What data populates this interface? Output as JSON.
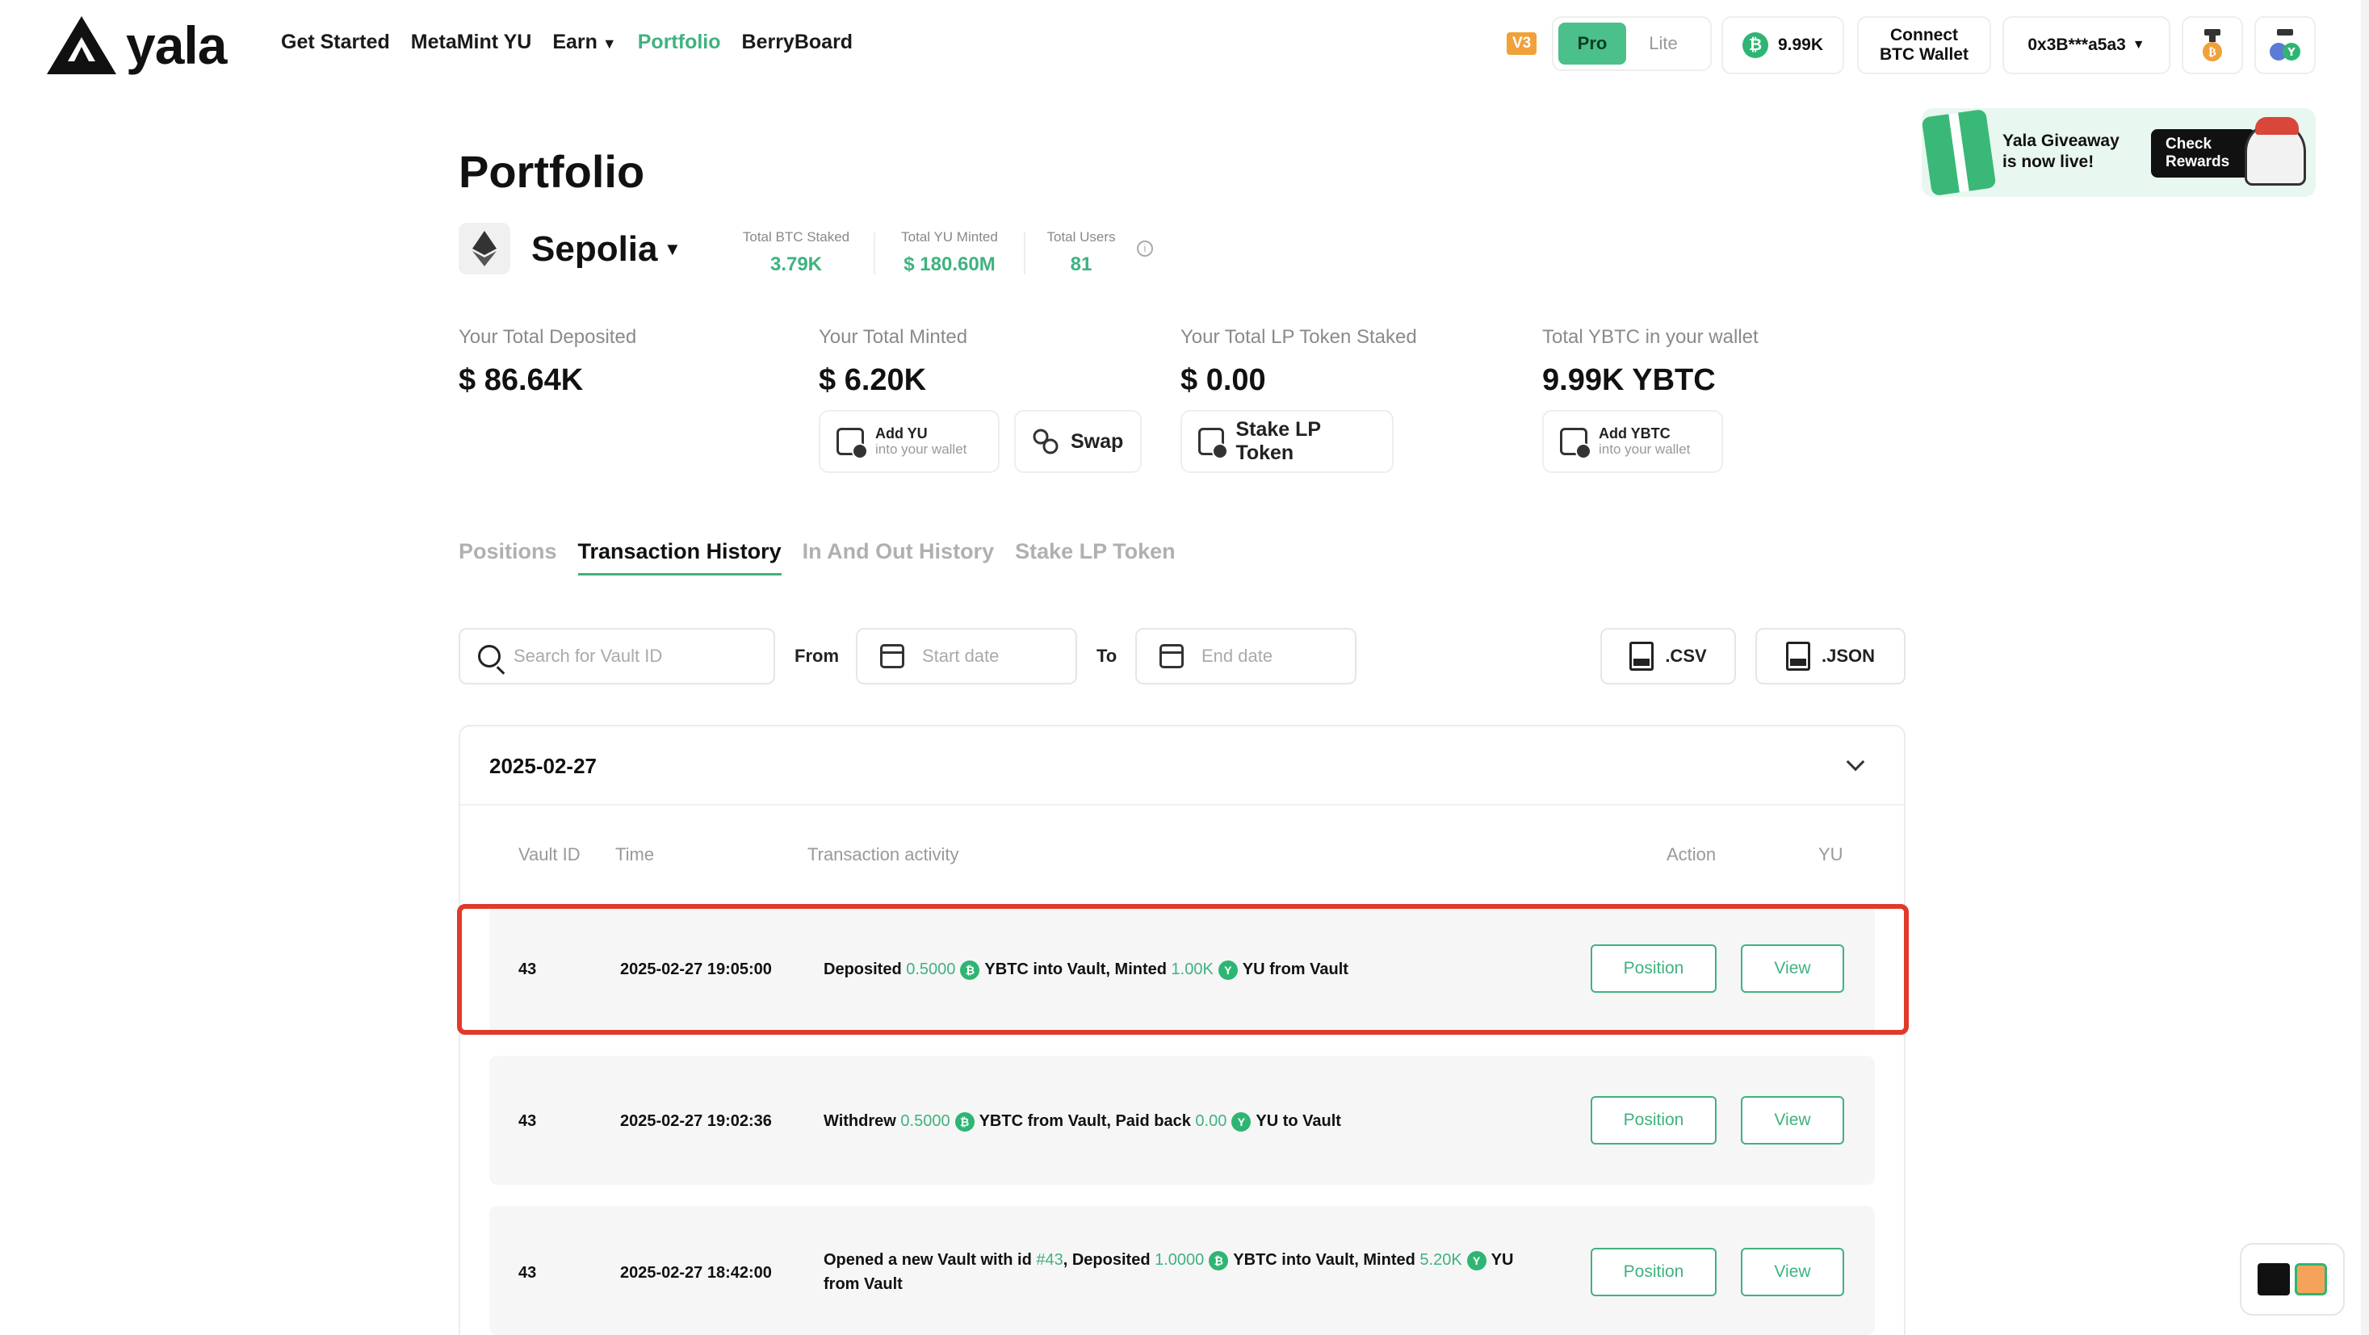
{
  "header": {
    "logo_text": "yala",
    "nav": [
      "Get Started",
      "MetaMint YU",
      "Earn",
      "Portfolio",
      "BerryBoard"
    ],
    "version_badge": "V3",
    "mode": {
      "pro": "Pro",
      "lite": "Lite"
    },
    "balance": "9.99K",
    "connect_line1": "Connect",
    "connect_line2": "BTC Wallet",
    "address": "0x3B***a5a3"
  },
  "giveaway": {
    "line1": "Yala Giveaway",
    "line2": "is now live!",
    "button_line1": "Check",
    "button_line2": "Rewards"
  },
  "page": {
    "title": "Portfolio",
    "network": "Sepolia",
    "stats": [
      {
        "label": "Total BTC Staked",
        "value": "3.79K"
      },
      {
        "label": "Total YU Minted",
        "value": "$ 180.60M"
      },
      {
        "label": "Total Users",
        "value": "81"
      }
    ]
  },
  "summary": [
    {
      "label": "Your Total Deposited",
      "value": "$ 86.64K"
    },
    {
      "label": "Your Total Minted",
      "value": "$ 6.20K"
    },
    {
      "label": "Your Total LP Token Staked",
      "value": "$ 0.00"
    },
    {
      "label": "Total YBTC in your wallet",
      "value": "9.99K YBTC"
    }
  ],
  "actions": {
    "add_yu": {
      "title": "Add YU",
      "sub": "into your wallet"
    },
    "swap": "Swap",
    "stake_lp": "Stake LP Token",
    "add_ybtc": {
      "title": "Add YBTC",
      "sub": "into your wallet"
    }
  },
  "tabs": [
    "Positions",
    "Transaction History",
    "In And Out History",
    "Stake LP Token"
  ],
  "filters": {
    "search_placeholder": "Search for Vault ID",
    "from": "From",
    "start_placeholder": "Start date",
    "to": "To",
    "end_placeholder": "End date",
    "csv": ".CSV",
    "json": ".JSON"
  },
  "table": {
    "date": "2025-02-27",
    "columns": [
      "Vault ID",
      "Time",
      "Transaction activity",
      "Action",
      "YU"
    ],
    "rows": [
      {
        "vault": "43",
        "time": "2025-02-27 19:05:00",
        "a1": "Deposited",
        "v1": "0.5000",
        "a2": "YBTC into Vault, Minted",
        "v2": "1.00K",
        "a3": "YU from Vault",
        "position": "Position",
        "view": "View"
      },
      {
        "vault": "43",
        "time": "2025-02-27 19:02:36",
        "a1": "Withdrew",
        "v1": "0.5000",
        "a2": "YBTC from Vault, Paid back",
        "v2": "0.00",
        "a3": "YU to Vault",
        "position": "Position",
        "view": "View"
      },
      {
        "vault": "43",
        "time": "2025-02-27 18:42:00",
        "a0": "Opened a new Vault with id",
        "id": "#43",
        "a1": ", Deposited",
        "v1": "1.0000",
        "a2": "YBTC into Vault, Minted",
        "v2": "5.20K",
        "a3": "YU from Vault",
        "position": "Position",
        "view": "View"
      }
    ]
  },
  "colors": {
    "accent": "#3fb27f",
    "highlight": "#e03a2a",
    "badge": "#f0a13a"
  },
  "icons": [
    "yala-logo-icon",
    "bitcoin-icon",
    "ethereum-icon",
    "search-icon",
    "calendar-icon",
    "csv-file-icon",
    "json-file-icon",
    "chevron-down-icon",
    "info-icon",
    "wallet-icon",
    "swap-icon"
  ]
}
